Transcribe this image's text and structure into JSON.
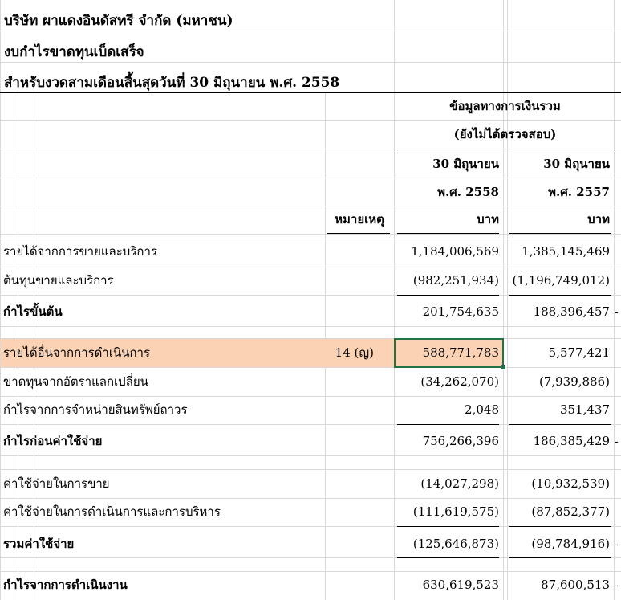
{
  "header": {
    "company": "บริษัท ผาแดงอินดัสทรี จำกัด (มหาชน)",
    "statement": "งบกำไรขาดทุนเบ็ดเสร็จ",
    "period": "สำหรับงวดสามเดือนสิ้นสุดวันที่ 30 มิถุนายน พ.ศ. 2558"
  },
  "columns": {
    "group_title": "ข้อมูลทางการเงินรวม",
    "group_subtitle": "(ยังไม่ได้ตรวจสอบ)",
    "note_header": "หมายเหตุ",
    "col1_date": "30 มิถุนายน",
    "col1_year": "พ.ศ. 2558",
    "col1_unit": "บาท",
    "col2_date": "30 มิถุนายน",
    "col2_year": "พ.ศ. 2557",
    "col2_unit": "บาท"
  },
  "rows": [
    {
      "label": "รายได้จากการขายและบริการ",
      "note": "",
      "v1": "1,184,006,569",
      "v2": "1,385,145,469",
      "bold": false
    },
    {
      "label": "ต้นทุนขายและบริการ",
      "note": "",
      "v1": "(982,251,934)",
      "v2": "(1,196,749,012)",
      "bold": false
    },
    {
      "label": "กำไรขั้นต้น",
      "note": "",
      "v1": "201,754,635",
      "v2": "188,396,457",
      "bold": true
    },
    {
      "label": "รายได้อื่นจากการดำเนินการ",
      "note": "14 (ญ)",
      "v1": "588,771,783",
      "v2": "5,577,421",
      "bold": false
    },
    {
      "label": "ขาดทุนจากอัตราแลกเปลี่ยน",
      "note": "",
      "v1": "(34,262,070)",
      "v2": "(7,939,886)",
      "bold": false
    },
    {
      "label": "กำไรจากการจำหน่ายสินทรัพย์ถาวร",
      "note": "",
      "v1": "2,048",
      "v2": "351,437",
      "bold": false
    },
    {
      "label": "กำไรก่อนค่าใช้จ่าย",
      "note": "",
      "v1": "756,266,396",
      "v2": "186,385,429",
      "bold": true
    },
    {
      "label": "ค่าใช้จ่ายในการขาย",
      "note": "",
      "v1": "(14,027,298)",
      "v2": "(10,932,539)",
      "bold": false
    },
    {
      "label": "ค่าใช้จ่ายในการดำเนินการและการบริหาร",
      "note": "",
      "v1": "(111,619,575)",
      "v2": "(87,852,377)",
      "bold": false
    },
    {
      "label": "รวมค่าใช้จ่าย",
      "note": "",
      "v1": "(125,646,873)",
      "v2": "(98,784,916)",
      "bold": true
    },
    {
      "label": "กำไรจากการดำเนินงาน",
      "note": "",
      "v1": "630,619,523",
      "v2": "87,600,513",
      "bold": true
    }
  ],
  "side_dash": "-"
}
